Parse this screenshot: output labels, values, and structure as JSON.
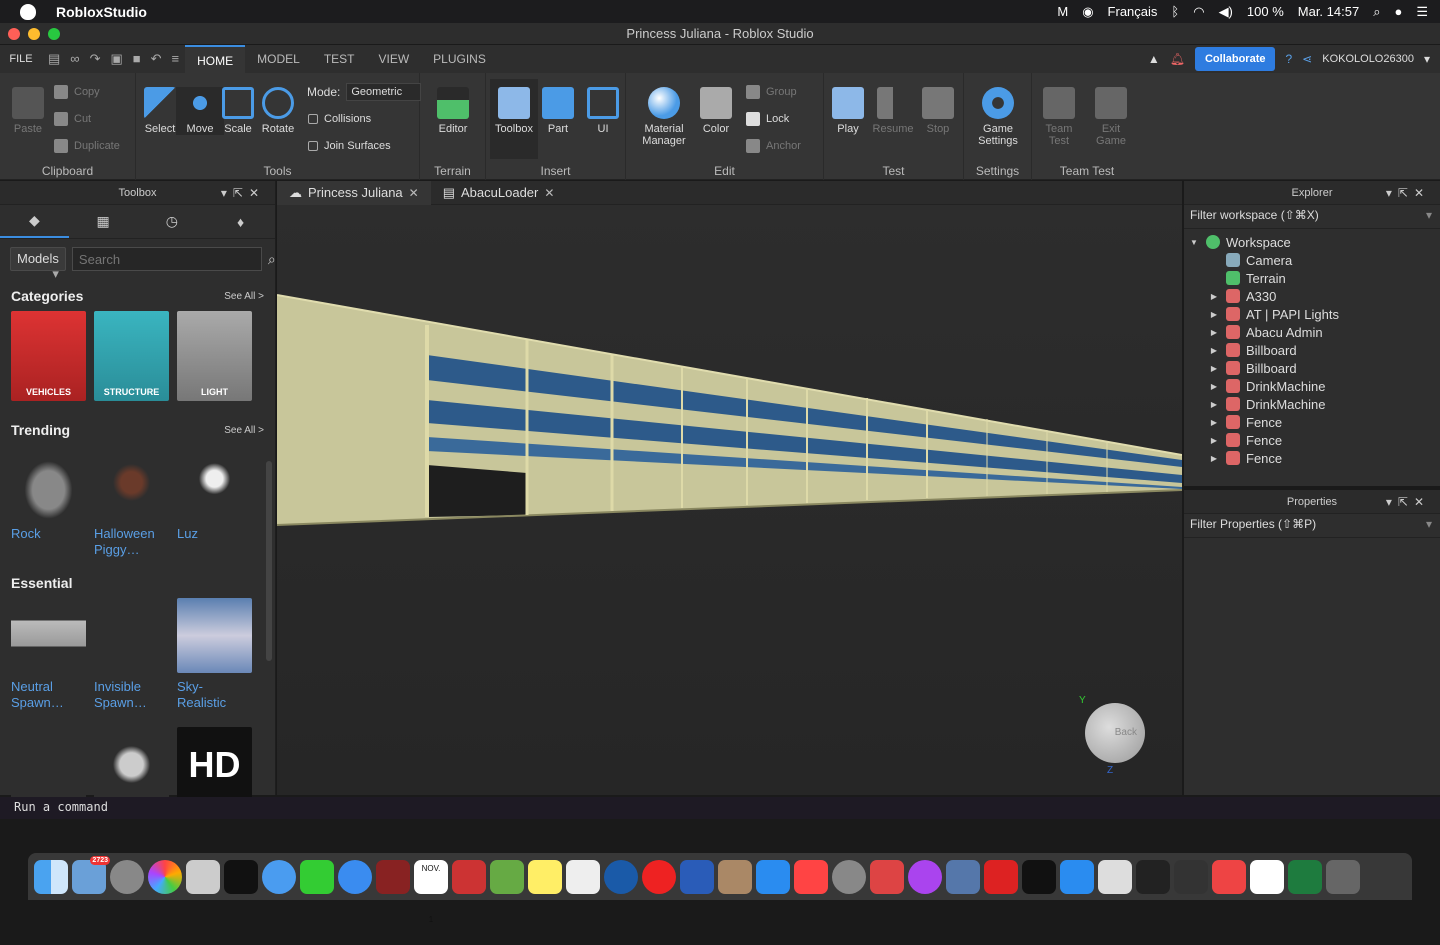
{
  "menubar": {
    "app_name": "RobloxStudio",
    "language": "Français",
    "battery": "100 %",
    "clock": "Mar. 14:57"
  },
  "window": {
    "title": "Princess Juliana - Roblox Studio"
  },
  "ribbon_tabs": {
    "file": "FILE",
    "tabs": [
      {
        "label": "HOME"
      },
      {
        "label": "MODEL"
      },
      {
        "label": "TEST"
      },
      {
        "label": "VIEW"
      },
      {
        "label": "PLUGINS"
      }
    ],
    "collaborate": "Collaborate",
    "username": "KOKOLOLO26300"
  },
  "ribbon": {
    "clipboard": {
      "paste": "Paste",
      "copy": "Copy",
      "cut": "Cut",
      "duplicate": "Duplicate",
      "label": "Clipboard"
    },
    "tools": {
      "select": "Select",
      "move": "Move",
      "scale": "Scale",
      "rotate": "Rotate",
      "mode_label": "Mode:",
      "mode_value": "Geometric",
      "collisions": "Collisions",
      "join_surfaces": "Join Surfaces",
      "label": "Tools"
    },
    "terrain": {
      "editor": "Editor",
      "label": "Terrain"
    },
    "insert": {
      "toolbox": "Toolbox",
      "part": "Part",
      "ui": "UI",
      "label": "Insert"
    },
    "edit": {
      "material_manager_1": "Material",
      "material_manager_2": "Manager",
      "color": "Color",
      "group": "Group",
      "lock": "Lock",
      "anchor": "Anchor",
      "label": "Edit"
    },
    "test": {
      "play": "Play",
      "resume": "Resume",
      "stop": "Stop",
      "label": "Test"
    },
    "settings": {
      "game_settings_1": "Game",
      "game_settings_2": "Settings",
      "label": "Settings"
    },
    "team_test": {
      "team_test_1": "Team",
      "team_test_2": "Test",
      "exit_game_1": "Exit",
      "exit_game_2": "Game",
      "label": "Team Test"
    }
  },
  "toolbox": {
    "title": "Toolbox",
    "category_dropdown": "Models",
    "search_placeholder": "Search",
    "categories_heading": "Categories",
    "see_all": "See All >",
    "categories": [
      {
        "label": "VEHICLES"
      },
      {
        "label": "STRUCTURE"
      },
      {
        "label": "LIGHT"
      }
    ],
    "trending_heading": "Trending",
    "trending": [
      {
        "name": "Rock"
      },
      {
        "name": "Halloween Piggy…"
      },
      {
        "name": "Luz"
      }
    ],
    "essential_heading": "Essential",
    "essential": [
      {
        "name": "Neutral Spawn…"
      },
      {
        "name": "Invisible Spawn…"
      },
      {
        "name": "Sky-Realistic"
      }
    ],
    "hd_label": "HD"
  },
  "doc_tabs": [
    {
      "label": "Princess Juliana"
    },
    {
      "label": "AbacuLoader"
    }
  ],
  "viewcube": {
    "back": "Back",
    "y_axis": "Y",
    "z_axis": "Z"
  },
  "explorer": {
    "title": "Explorer",
    "filter_placeholder": "Filter workspace (⇧⌘X)",
    "items": [
      {
        "name": "Workspace"
      },
      {
        "name": "Camera"
      },
      {
        "name": "Terrain"
      },
      {
        "name": "A330"
      },
      {
        "name": "AT | PAPI Lights"
      },
      {
        "name": "Abacu Admin"
      },
      {
        "name": "Billboard"
      },
      {
        "name": "Billboard"
      },
      {
        "name": "DrinkMachine"
      },
      {
        "name": "DrinkMachine"
      },
      {
        "name": "Fence"
      },
      {
        "name": "Fence"
      },
      {
        "name": "Fence"
      }
    ]
  },
  "properties": {
    "title": "Properties",
    "filter_placeholder": "Filter Properties (⇧⌘P)"
  },
  "command_bar": {
    "placeholder": "Run a command"
  },
  "dock": {
    "mail_badge": "2723",
    "calendar_month": "NOV.",
    "calendar_day": "1"
  }
}
